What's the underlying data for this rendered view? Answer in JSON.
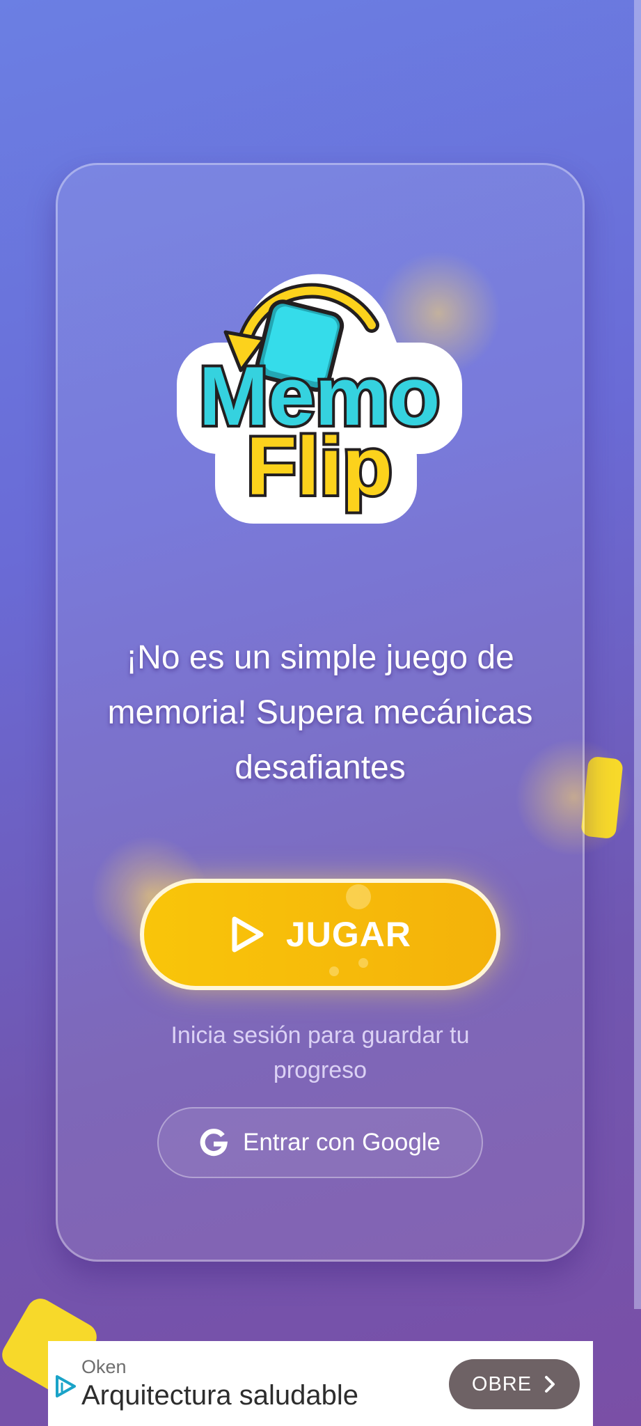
{
  "app": {
    "logo_line1": "Memo",
    "logo_line2": "Flip",
    "tagline": "¡No es un simple juego de memoria! Supera mecánicas desafiantes",
    "play_label": "JUGAR",
    "login_hint": "Inicia sesión para guardar tu progreso",
    "google_label": "Entrar con Google"
  },
  "ad": {
    "advertiser": "Oken",
    "headline": "Arquitectura saludable",
    "cta_label": "OBRE"
  },
  "icons": {
    "logo": "memo-flip-logo",
    "play": "play-icon",
    "google": "google-icon",
    "ad_choices": "ad-choices-icon",
    "cta_arrow": "chevron-right-icon"
  },
  "colors": {
    "background_top": "#6b7fe3",
    "background_bottom": "#7a4fa6",
    "play_button": "#f9c50a",
    "logo_memo": "#2fd3e0",
    "logo_flip": "#fcd21c",
    "ad_cta": "#6e6265",
    "ad_icon": "#1aa3c8"
  }
}
